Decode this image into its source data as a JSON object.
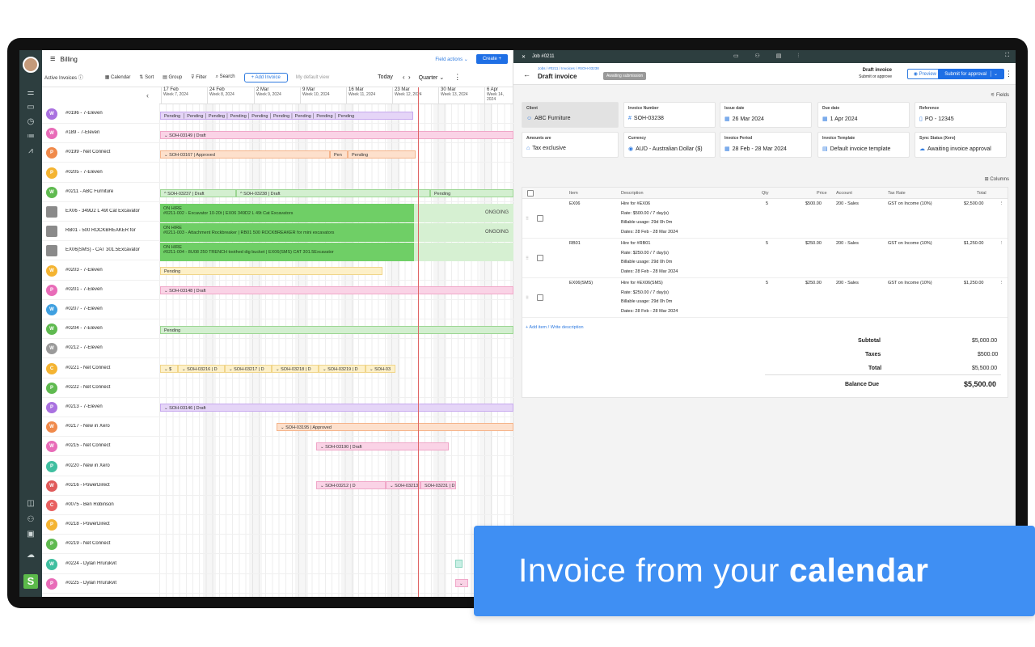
{
  "left": {
    "title": "Billing",
    "field_actions": "Field actions",
    "create_label": "Create",
    "active_invoices": "Active Invoices",
    "toolbar": {
      "calendar": "Calendar",
      "sort": "Sort",
      "group": "Group",
      "filter": "Filter",
      "search": "Search",
      "add_invoice": "+ Add Invoice",
      "default_view": "My default view",
      "today": "Today",
      "quarter": "Quarter"
    },
    "weeks": [
      {
        "date": "17 Feb",
        "week": "Week 7, 2024"
      },
      {
        "date": "24 Feb",
        "week": "Week 8, 2024"
      },
      {
        "date": "2 Mar",
        "week": "Week 9, 2024"
      },
      {
        "date": "9 Mar",
        "week": "Week 10, 2024"
      },
      {
        "date": "16 Mar",
        "week": "Week 11, 2024"
      },
      {
        "date": "23 Mar",
        "week": "Week 12, 2024"
      },
      {
        "date": "30 Mar",
        "week": "Week 13, 2024"
      },
      {
        "date": "6 Apr",
        "week": "Week 14, 2024"
      }
    ],
    "rows": [
      {
        "initial": "W",
        "color": "#a971e0",
        "label": "#0196 - 7-Eleven"
      },
      {
        "initial": "W",
        "color": "#e86cb8",
        "label": "#189 - 7-Eleven"
      },
      {
        "initial": "P",
        "color": "#f08a4b",
        "label": "#0199 - Net Connect"
      },
      {
        "initial": "P",
        "color": "#f4b432",
        "label": "#0205 - 7-Eleven"
      },
      {
        "initial": "W",
        "color": "#5fba50",
        "label": "#0211 - ABC Furniture"
      },
      {
        "initial": "",
        "color": "",
        "label": "EX06 - 349D2 L 49t Cat Excavator"
      },
      {
        "initial": "",
        "color": "",
        "label": "RB01 - 500 ROCKBREAKER for"
      },
      {
        "initial": "",
        "color": "",
        "label": "EX06(SMS) - CAT 301.5Excavator"
      },
      {
        "initial": "W",
        "color": "#f4b432",
        "label": "#0203 - 7-Eleven"
      },
      {
        "initial": "P",
        "color": "#e86cb8",
        "label": "#0201 - 7-Eleven"
      },
      {
        "initial": "W",
        "color": "#3fa0e0",
        "label": "#0207 - 7-Eleven"
      },
      {
        "initial": "W",
        "color": "#5fba50",
        "label": "#0204 - 7-Eleven"
      },
      {
        "initial": "W",
        "color": "#9a9a9a",
        "label": "#0212 - 7-Eleven"
      },
      {
        "initial": "C",
        "color": "#f4b432",
        "label": "#0221 - Net Connect"
      },
      {
        "initial": "P",
        "color": "#5fba50",
        "label": "#0222 - Net Connect"
      },
      {
        "initial": "P",
        "color": "#a971e0",
        "label": "#0213 - 7-Eleven"
      },
      {
        "initial": "W",
        "color": "#f08a4b",
        "label": "#0217 - New in Xero"
      },
      {
        "initial": "W",
        "color": "#e86cb8",
        "label": "#0215 - Net Connect"
      },
      {
        "initial": "P",
        "color": "#3fbfa0",
        "label": "#0220 - New in Xero"
      },
      {
        "initial": "W",
        "color": "#e05a5a",
        "label": "#0216 - PowerDirect"
      },
      {
        "initial": "C",
        "color": "#e86060",
        "label": "#0075 - Ben Robinson"
      },
      {
        "initial": "P",
        "color": "#f4b432",
        "label": "#0218 - PowerDirect"
      },
      {
        "initial": "P",
        "color": "#5fba50",
        "label": "#0219 - Net Connect"
      },
      {
        "initial": "W",
        "color": "#3fbfa0",
        "label": "#0224 - Dylan Hrurukvit"
      },
      {
        "initial": "P",
        "color": "#e86cb8",
        "label": "#0225 - Dylan Hrurukvit"
      }
    ],
    "bars": {
      "pending": "Pending",
      "b189": "⌄  SOH-03149 | Draft",
      "b199": "⌄  SOH-03167 | Approved",
      "b199b": "Pen",
      "b199c": "Pending",
      "b211a": "^  SOH-03237 | Draft",
      "b211b": "^  SOH-03238 | Draft",
      "b211c": "Pending",
      "b203": "Pending",
      "b201": "⌄  SOH-03148 | Draft",
      "b204": "Pending",
      "b221": [
        "⌄  $",
        "⌄  SOH-03216 | D",
        "⌄  SOH-03217 | D",
        "⌄  SOH-03218 | D",
        "⌄  SOH-03219 | D",
        "⌄  SOH-03"
      ],
      "b213": "⌄  SOH-03146 | Draft",
      "b217": "⌄  SOH-03195 | Approved",
      "b215": "⌄  SOH-03190 | Draft",
      "b216": [
        "⌄  SOH-03212 | D",
        "⌄  SOH-03213 | D",
        "SOH-03231 | D"
      ],
      "b225": "⌄"
    },
    "hires": [
      {
        "title": "ON HIRE",
        "detail": "#0211-002 - Excavator 10-20t | EX06 349D2 L 49t Cat Excavators",
        "status": "ONGOING"
      },
      {
        "title": "ON HIRE",
        "detail": "#0211-003 - Attachment Rockbreaker | RB01 500 ROCKBREAKER for mini excavators",
        "status": "ONGOING"
      },
      {
        "title": "ON HIRE",
        "detail": "#0211-004 - 8U08 250 TRENCH toothed dig bucket | EX06(SMS) CAT 301.5Excavator",
        "status": ""
      }
    ]
  },
  "right": {
    "job": "Job #0211",
    "breadcrumb": "Jobs / #0211 / Invoices / #SOH-03238",
    "title": "Draft invoice",
    "badge": "Awaiting submission",
    "status_title": "Draft invoice",
    "status_sub": "Submit or approve",
    "preview": "Preview",
    "submit": "Submit for approval",
    "fields": "Fields",
    "cards": [
      {
        "label": "Client",
        "value": "ABC Furniture",
        "icon": "☺"
      },
      {
        "label": "Invoice Number",
        "value": "SOH-03238",
        "icon": "#"
      },
      {
        "label": "Issue date",
        "value": "26 Mar 2024",
        "icon": "▦"
      },
      {
        "label": "Due date",
        "value": "1 Apr 2024",
        "icon": "▦"
      },
      {
        "label": "Reference",
        "value": "PO - 12345",
        "icon": "▯"
      },
      {
        "label": "Amounts are",
        "value": "Tax exclusive",
        "icon": "⌂"
      },
      {
        "label": "Currency",
        "value": "AUD - Australian Dollar ($)",
        "icon": "◉"
      },
      {
        "label": "Invoice Period",
        "value": "28 Feb - 28 Mar 2024",
        "icon": "▦"
      },
      {
        "label": "Invoice Template",
        "value": "Default invoice template",
        "icon": "▤"
      },
      {
        "label": "Sync Status (Xero)",
        "value": "Awaiting invoice approval",
        "icon": "☁"
      }
    ],
    "columns_label": "Columns",
    "headers": {
      "item": "Item",
      "desc": "Description",
      "qty": "Qty",
      "price": "Price",
      "account": "Account",
      "tax": "Tax Rate",
      "total": "Total"
    },
    "lines": [
      {
        "item": "EX06",
        "d1": "Hire for #EX06",
        "d2": "Rate: $500.00 / 7 day(s)",
        "d3": "Billable usage: 29d 0h 0m",
        "d4": "Dates: 28 Feb - 28 Mar 2024",
        "qty": "5",
        "price": "$500.00",
        "account": "200 - Sales",
        "tax": "GST on Income (10%)",
        "total": "$2,500.00"
      },
      {
        "item": "RB01",
        "d1": "Hire for #RB01",
        "d2": "Rate: $250.00 / 7 day(s)",
        "d3": "Billable usage: 29d 0h 0m",
        "d4": "Dates: 28 Feb - 28 Mar 2024",
        "qty": "5",
        "price": "$250.00",
        "account": "200 - Sales",
        "tax": "GST on Income (10%)",
        "total": "$1,250.00"
      },
      {
        "item": "EX06(SMS)",
        "d1": "Hire for #EX06(SMS)",
        "d2": "Rate: $250.00 / 7 day(s)",
        "d3": "Billable usage: 29d 0h 0m",
        "d4": "Dates: 28 Feb - 28 Mar 2024",
        "qty": "5",
        "price": "$250.00",
        "account": "200 - Sales",
        "tax": "GST on Income (10%)",
        "total": "$1,250.00"
      }
    ],
    "add_item": "+ Add item / Write description",
    "subtotal_label": "Subtotal",
    "subtotal": "$5,000.00",
    "taxes_label": "Taxes",
    "taxes": "$500.00",
    "total_label": "Total",
    "total": "$5,500.00",
    "balance_label": "Balance Due",
    "balance": "$5,500.00"
  },
  "banner": {
    "text": "Invoice from your",
    "bold": "calendar"
  }
}
